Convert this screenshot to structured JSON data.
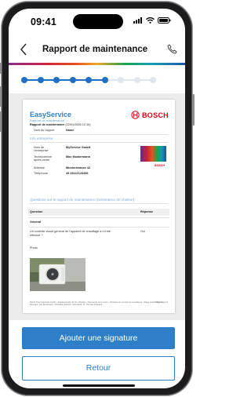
{
  "status_bar": {
    "time": "09:41"
  },
  "header": {
    "back_icon": "chevron-left-icon",
    "title": "Rapport de maintenance",
    "action_icon": "phone-icon"
  },
  "stepper": {
    "total_steps": 9,
    "completed_steps": 6,
    "active_color": "#1f6fc5",
    "inactive_color": "#dfe6ee"
  },
  "document": {
    "brand": "EasyService",
    "brand_subtitle": "Rapport de maintenance",
    "manufacturer": "BOSCH",
    "report_label": "Rapport de maintenance",
    "report_date": "(22/01/2026 12:10)",
    "report_number_label": "Nom du rapport",
    "report_number_value": "Name",
    "company_section": "Info entreprise",
    "company_rows": [
      {
        "label": "Nom de l'entreprise",
        "value": "MyService GmbH"
      },
      {
        "label": "Technicien/ne après-vente",
        "value": "Max Mustermann"
      },
      {
        "label": "Adresse",
        "value": "Musterstrasse 42"
      },
      {
        "label": "Téléphone",
        "value": "49 15222123456"
      }
    ],
    "mini_logo": "BOSCH",
    "questions_section": "Questions sur le rapport de maintenance (Générateur de chaleur)",
    "col_question": "Question",
    "col_answer": "Réponse",
    "group": "Général",
    "question_1": "Un contrôle visuel général de l'appareil de chauffage a-t-il été effectué ?",
    "answer_1": "Oui",
    "photo_label": "Photo",
    "footer": "Bosch Thermotechnik GmbH • Sophienstraße 30-32 • Wetzlar • Tribunal de Commerce • Président de conseil de surveillance • Siège social: Wetzlar • Directeur: Jan Brockmann, Christiane Dürholt, Uwe Glock, Dr. Thomas Schwenk",
    "page": "Page 1 sur 16"
  },
  "buttons": {
    "primary": "Ajouter une signature",
    "secondary": "Retour"
  }
}
